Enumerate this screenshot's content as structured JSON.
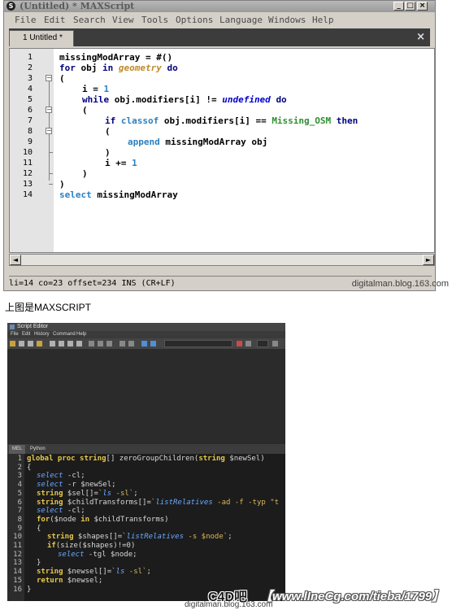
{
  "maxscript": {
    "title": "(Untitled) * MAXScript",
    "app_icon": "S",
    "controls": {
      "minimize": "_",
      "maximize": "□",
      "close": "×"
    },
    "menu": [
      "File",
      "Edit",
      "Search",
      "View",
      "Tools",
      "Options",
      "Language",
      "Windows",
      "Help"
    ],
    "tab": {
      "label": "1 Untitled *",
      "close": "×"
    },
    "line_numbers": [
      "1",
      "2",
      "3",
      "4",
      "5",
      "6",
      "7",
      "8",
      "9",
      "10",
      "11",
      "12",
      "13",
      "14"
    ],
    "code": [
      "missingModArray = #()",
      "for obj in geometry do",
      "(",
      "i = 1",
      "while obj.modifiers[i] != undefined do",
      "(",
      "if classof obj.modifiers[i] == Missing_OSM then",
      "(",
      "append missingModArray obj",
      ")",
      "i += 1",
      ")",
      ")",
      "select missingModArray"
    ],
    "scroll_left": "◄",
    "scroll_right": "►",
    "status": "li=14 co=23 offset=234 INS (CR+LF)",
    "watermark": "digitalman.blog.163.com"
  },
  "caption": "上图是MAXSCRIPT",
  "maya": {
    "title": "Script Editor",
    "menu": [
      "File",
      "Edit",
      "History",
      "Command",
      "Help"
    ],
    "tabs": [
      "MEL",
      "Python"
    ],
    "line_numbers": [
      "1",
      "2",
      "3",
      "4",
      "5",
      "6",
      "7",
      "8",
      "9",
      "10",
      "11",
      "12",
      "13",
      "14",
      "15",
      "16"
    ],
    "code": [
      "global proc string[] zeroGroupChildren(string $newSel)",
      "{",
      "select -cl;",
      "select -r $newSel;",
      "string $sel[]=`ls -sl`;",
      "string $childTransforms[]=`listRelatives -ad -f -typ \"t",
      "select -cl;",
      "for($node in $childTransforms)",
      "{",
      "string $shapes[]=`listRelatives -s $node`;",
      "if(size($shapes)!=0)",
      "select -tgl $node;",
      "}",
      "string $newsel[]=`ls -sl`;",
      "return $newsel;",
      "}"
    ],
    "watermark": "digitalman.blog.163.com"
  },
  "overlay": {
    "site": "C4D吧",
    "url": "【www.lIneCg.com/tieba/1799】"
  }
}
